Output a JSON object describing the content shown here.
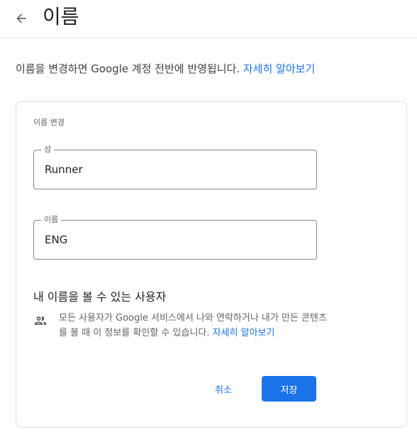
{
  "header": {
    "back_icon": "arrow-back-icon",
    "title": "이름"
  },
  "intro": {
    "text": "이름을 변경하면 Google 계정 전반에 반영됩니다. ",
    "link": "자세히 알아보기"
  },
  "card": {
    "title": "이름 변경",
    "fields": [
      {
        "label": "성",
        "value": "Runner"
      },
      {
        "label": "이름",
        "value": "ENG"
      }
    ],
    "visibility": {
      "title": "내 이름을 볼 수 있는 사용자",
      "icon": "people-icon",
      "description": "모든 사용자가 Google 서비스에서 나와 연락하거나 내가 만든 콘텐츠를 볼 때 이 정보를 확인할 수 있습니다. ",
      "link": "자세히 알아보기"
    },
    "buttons": {
      "cancel": "취소",
      "save": "저장"
    }
  },
  "colors": {
    "accent": "#1a73e8",
    "text_primary": "#202124",
    "text_secondary": "#5f6368",
    "border": "#dadce0"
  }
}
